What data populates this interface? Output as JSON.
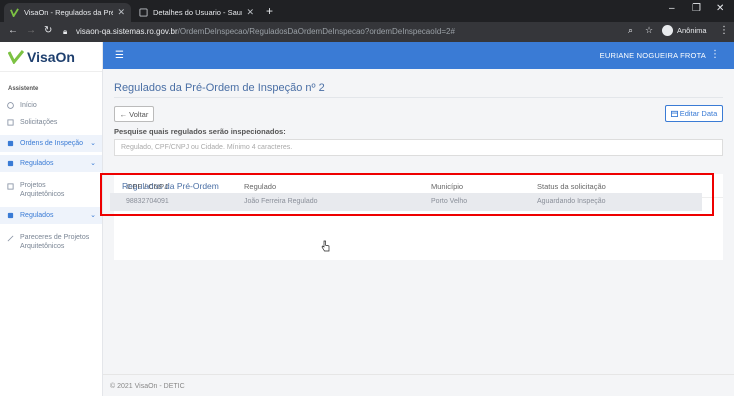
{
  "browser": {
    "tabs": [
      {
        "title": "VisaOn - Regulados da Pré-Orde",
        "active": true
      },
      {
        "title": "Detalhes do Usuario - Sauron.Gr",
        "active": false
      }
    ],
    "new_tab": "+",
    "url_domain": "visaon-qa.sistemas.ro.gov.br",
    "url_path": "/OrdemDeInspecao/ReguladosDaOrdemDeInspecao?ordemDeInspecaoId=2#",
    "profile": "Anônima"
  },
  "app": {
    "logo_text": "VisaOn",
    "user_name": "EURIANE NOGUEIRA FROTA",
    "accent": "#3a7bd5"
  },
  "sidebar": {
    "section": "Assistente",
    "items": [
      {
        "label": "Início",
        "icon": "dashboard-icon"
      },
      {
        "label": "Solicitações",
        "icon": "document-icon"
      },
      {
        "label": "Ordens de Inspeção",
        "icon": "gear-icon"
      },
      {
        "label": "Regulados",
        "icon": "gear-icon"
      },
      {
        "label": "Projetos Arquitetônicos",
        "icon": "folder-icon"
      },
      {
        "label": "Regulados",
        "icon": "folder-icon"
      },
      {
        "label": "Pareceres de Projetos Arquitetônicos",
        "icon": "pencil-icon"
      }
    ]
  },
  "page": {
    "title": "Regulados da Pré-Ordem de Inspeção nº 2",
    "back_label": "Voltar",
    "edit_label": "Editar Data",
    "search_label": "Pesquise quais regulados serão inspecionados:",
    "search_placeholder": "Regulado, CPF/CNPJ ou Cidade. Mínimo 4 caracteres.",
    "card_title": "Regulados da Pré-Ordem",
    "table": {
      "headers": [
        "CPF / CNPJ",
        "Regulado",
        "Município",
        "Status da solicitação"
      ],
      "rows": [
        [
          "98832704091",
          "João Ferreira Regulado",
          "Porto Velho",
          "Aguardando Inspeção"
        ]
      ]
    },
    "footer": "© 2021 VisaOn - DETIC"
  }
}
